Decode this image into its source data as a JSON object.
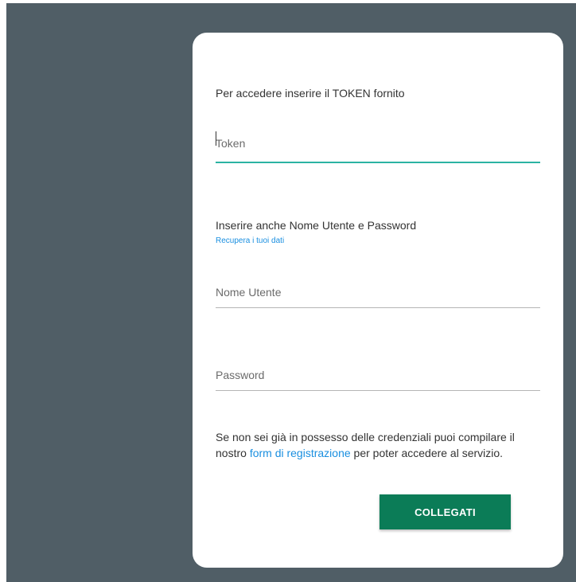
{
  "login": {
    "intro": "Per accedere inserire il TOKEN fornito",
    "token_placeholder": "Token",
    "second_intro": "Inserire anche Nome Utente e Password",
    "recover_link": "Recupera i tuoi dati",
    "username_placeholder": "Nome Utente",
    "password_placeholder": "Password",
    "signup_before": "Se non sei già in possesso delle credenziali puoi compilare il nostro ",
    "signup_link": "form di registrazione",
    "signup_after": " per poter accedere al servizio.",
    "connect_label": "COLLEGATI"
  },
  "colors": {
    "backdrop": "#505e66",
    "focus_underline": "#2bb3a3",
    "link": "#1a8fe0",
    "button": "#0b7c57"
  }
}
